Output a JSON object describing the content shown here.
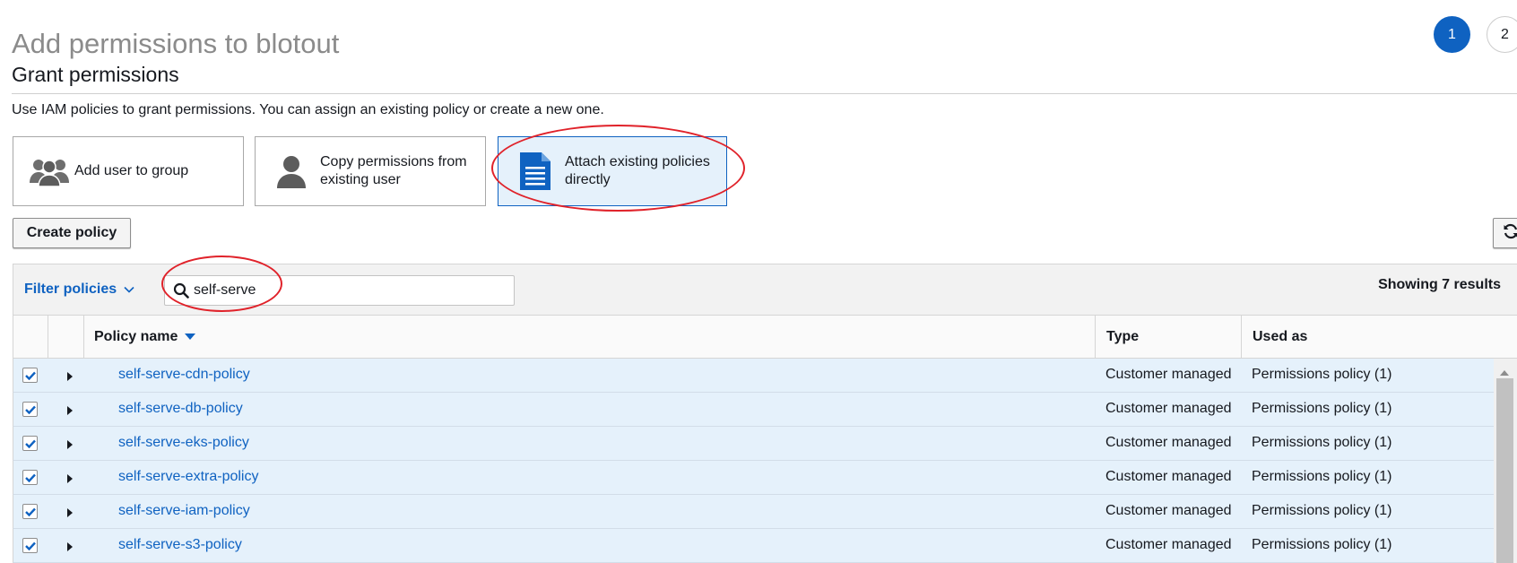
{
  "header": {
    "title": "Add permissions to blotout",
    "steps": [
      "1",
      "2"
    ]
  },
  "section": {
    "title": "Grant permissions",
    "description": "Use IAM policies to grant permissions. You can assign an existing policy or create a new one."
  },
  "options": [
    {
      "label_lines": [
        "Add user to group"
      ],
      "icon": "users-group-icon",
      "selected": false
    },
    {
      "label_lines": [
        "Copy permissions from",
        "existing user"
      ],
      "icon": "user-icon",
      "selected": false
    },
    {
      "label_lines": [
        "Attach existing policies",
        "directly"
      ],
      "icon": "document-icon",
      "selected": true
    }
  ],
  "toolbar": {
    "create_policy_label": "Create policy",
    "refresh_icon": "refresh-icon"
  },
  "filter": {
    "label": "Filter policies",
    "search_value": "self-serve",
    "results_text": "Showing 7 results"
  },
  "table": {
    "columns": [
      "Policy name",
      "Type",
      "Used as"
    ],
    "rows": [
      {
        "name": "self-serve-cdn-policy",
        "type": "Customer managed",
        "used_as": "Permissions policy (1)",
        "checked": true
      },
      {
        "name": "self-serve-db-policy",
        "type": "Customer managed",
        "used_as": "Permissions policy (1)",
        "checked": true
      },
      {
        "name": "self-serve-eks-policy",
        "type": "Customer managed",
        "used_as": "Permissions policy (1)",
        "checked": true
      },
      {
        "name": "self-serve-extra-policy",
        "type": "Customer managed",
        "used_as": "Permissions policy (1)",
        "checked": true
      },
      {
        "name": "self-serve-iam-policy",
        "type": "Customer managed",
        "used_as": "Permissions policy (1)",
        "checked": true
      },
      {
        "name": "self-serve-s3-policy",
        "type": "Customer managed",
        "used_as": "Permissions policy (1)",
        "checked": true
      }
    ]
  },
  "colors": {
    "accent": "#0f62c1",
    "selected_bg": "#e5f1fb",
    "annotation": "#e0222a"
  }
}
